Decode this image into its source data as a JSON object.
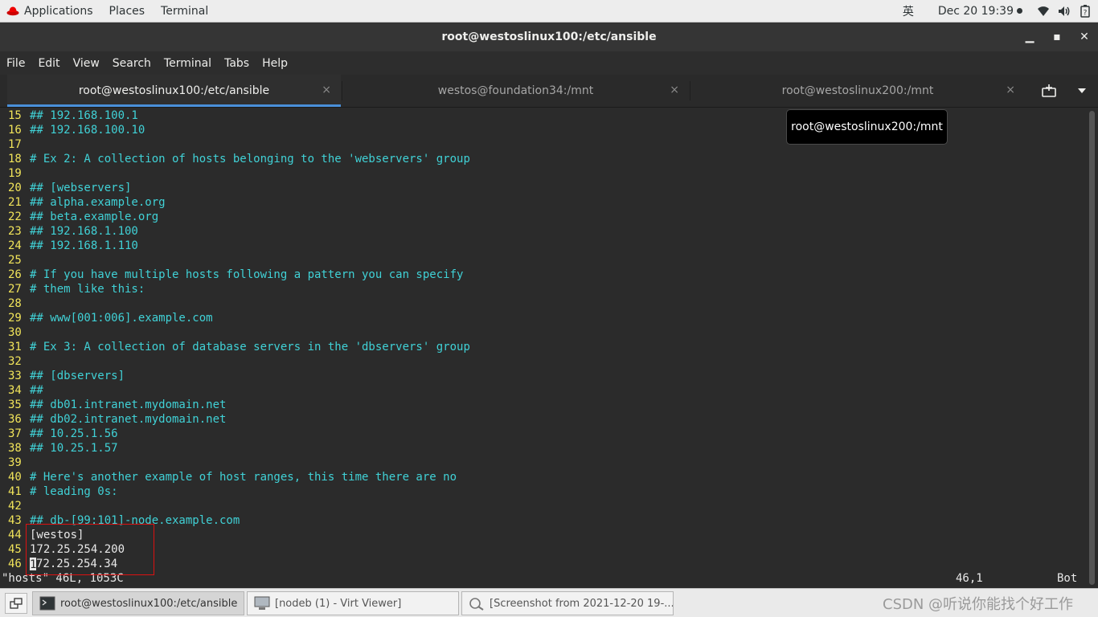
{
  "topbar": {
    "applications": "Applications",
    "places": "Places",
    "terminal": "Terminal",
    "input_method": "英",
    "clock": "Dec 20  19:39",
    "icons": [
      "network-wifi-icon",
      "volume-icon",
      "battery-icon"
    ]
  },
  "window": {
    "title": "root@westoslinux100:/etc/ansible",
    "minimize": "▁",
    "maximize": "▪",
    "close": "✕"
  },
  "menu": [
    "File",
    "Edit",
    "View",
    "Search",
    "Terminal",
    "Tabs",
    "Help"
  ],
  "tabs": [
    {
      "label": "root@westoslinux100:/etc/ansible",
      "active": true
    },
    {
      "label": "westos@foundation34:/mnt",
      "active": false
    },
    {
      "label": "root@westoslinux200:/mnt",
      "active": false
    }
  ],
  "tab_close": "×",
  "tooltip": "root@westoslinux200:/mnt",
  "editor": {
    "lines": [
      {
        "n": "15",
        "t": "## 192.168.100.1"
      },
      {
        "n": "16",
        "t": "## 192.168.100.10"
      },
      {
        "n": "17",
        "t": ""
      },
      {
        "n": "18",
        "t": "# Ex 2: A collection of hosts belonging to the 'webservers' group"
      },
      {
        "n": "19",
        "t": ""
      },
      {
        "n": "20",
        "t": "## [webservers]"
      },
      {
        "n": "21",
        "t": "## alpha.example.org"
      },
      {
        "n": "22",
        "t": "## beta.example.org"
      },
      {
        "n": "23",
        "t": "## 192.168.1.100"
      },
      {
        "n": "24",
        "t": "## 192.168.1.110"
      },
      {
        "n": "25",
        "t": ""
      },
      {
        "n": "26",
        "t": "# If you have multiple hosts following a pattern you can specify"
      },
      {
        "n": "27",
        "t": "# them like this:"
      },
      {
        "n": "28",
        "t": ""
      },
      {
        "n": "29",
        "t": "## www[001:006].example.com"
      },
      {
        "n": "30",
        "t": ""
      },
      {
        "n": "31",
        "t": "# Ex 3: A collection of database servers in the 'dbservers' group"
      },
      {
        "n": "32",
        "t": ""
      },
      {
        "n": "33",
        "t": "## [dbservers]"
      },
      {
        "n": "34",
        "t": "##"
      },
      {
        "n": "35",
        "t": "## db01.intranet.mydomain.net"
      },
      {
        "n": "36",
        "t": "## db02.intranet.mydomain.net"
      },
      {
        "n": "37",
        "t": "## 10.25.1.56"
      },
      {
        "n": "38",
        "t": "## 10.25.1.57"
      },
      {
        "n": "39",
        "t": ""
      },
      {
        "n": "40",
        "t": "# Here's another example of host ranges, this time there are no"
      },
      {
        "n": "41",
        "t": "# leading 0s:"
      },
      {
        "n": "42",
        "t": ""
      },
      {
        "n": "43",
        "t": "## db-[99:101]-node.example.com"
      },
      {
        "n": "44",
        "t": "[westos]"
      },
      {
        "n": "45",
        "t": "172.25.254.200"
      }
    ],
    "last_line": {
      "n": "46",
      "cursor_char": "1",
      "rest": "72.25.254.34"
    },
    "status_file": "\"hosts\" 46L, 1053C",
    "status_pos": "46,1",
    "status_pct": "Bot",
    "comment_color": "#40d1d6",
    "number_color": "#f1e45a"
  },
  "taskbar": {
    "tasks": [
      {
        "label": "root@westoslinux100:/etc/ansible",
        "active": true
      },
      {
        "label": "[nodeb (1) - Virt Viewer]",
        "active": false
      },
      {
        "label": "[Screenshot from 2021-12-20 19-...",
        "active": false
      }
    ],
    "watermark": "CSDN @听说你能找个好工作"
  }
}
